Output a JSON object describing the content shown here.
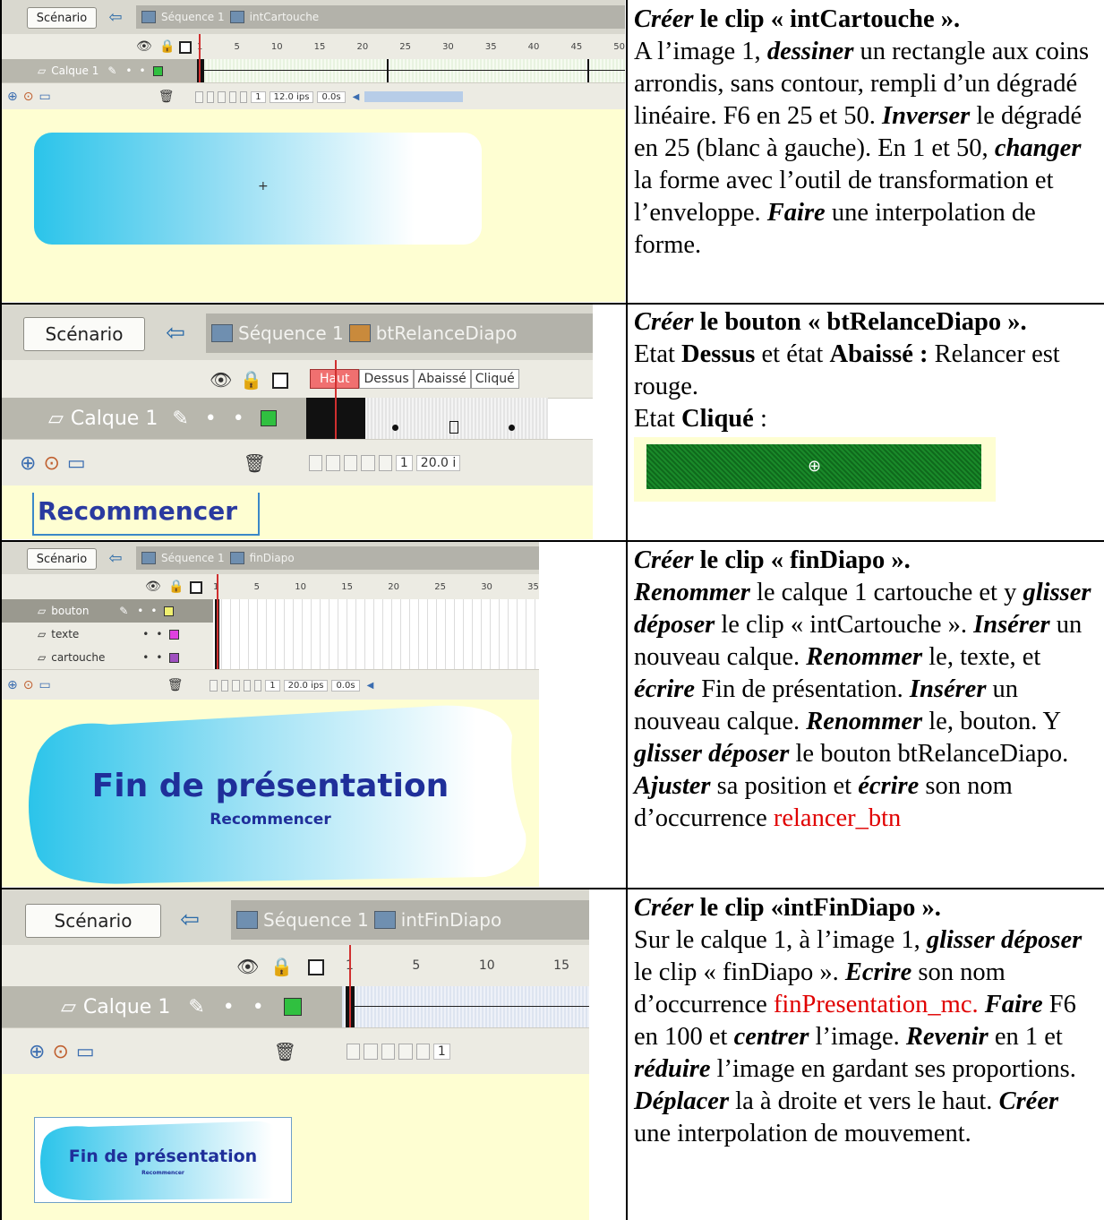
{
  "rows": [
    {
      "ui": {
        "scenario_label": "Scénario",
        "sequence_label": "Séquence 1",
        "symbol_label": "intCartouche",
        "frame_numbers": [
          "1",
          "5",
          "10",
          "15",
          "20",
          "25",
          "30",
          "35",
          "40",
          "45",
          "50"
        ],
        "layers": [
          "Calque 1"
        ],
        "frame_value": "1",
        "fps": "12.0 ips",
        "time": "0.0s"
      },
      "text": {
        "p1_a": "Créer",
        "p1_b": " le clip « intCartouche ».",
        "p2_a": "A l’image 1, ",
        "p2_b": "dessiner",
        "p2_c": " un rectangle aux coins arrondis, sans contour, rempli d’un dégradé linéaire. F6 en 25 et 50. ",
        "p2_d": "Inverser",
        "p2_e": " le dégradé en 25 (blanc à gauche). En 1 et 50, ",
        "p2_f": "changer",
        "p2_g": " la forme avec l’outil de transformation et l’enveloppe. ",
        "p2_h": "Faire",
        "p2_i": " une interpolation de forme."
      }
    },
    {
      "ui": {
        "scenario_label": "Scénario",
        "sequence_label": "Séquence 1",
        "symbol_label": "btRelanceDiapo",
        "states": [
          "Haut",
          "Dessus",
          "Abaissé",
          "Cliqué"
        ],
        "layers": [
          "Calque 1"
        ],
        "frame_value": "1",
        "fps": "20.0 i",
        "stage_text": "Recommencer"
      },
      "text": {
        "p1_a": "Créer",
        "p1_b": " le bouton « btRelanceDiapo ».",
        "p2_a": "Etat ",
        "p2_b": "Dessus",
        "p2_c": " et état ",
        "p2_d": "Abaissé :",
        "p2_e": " Relancer est rouge.",
        "p3_a": "Etat ",
        "p3_b": "Cliqué",
        "p3_c": " :"
      }
    },
    {
      "ui": {
        "scenario_label": "Scénario",
        "sequence_label": "Séquence 1",
        "symbol_label": "finDiapo",
        "frame_numbers": [
          "1",
          "5",
          "10",
          "15",
          "20",
          "25",
          "30",
          "35"
        ],
        "layers": [
          "bouton",
          "texte",
          "cartouche"
        ],
        "layer_colors": [
          "#f0f070",
          "#e040e0",
          "#a050c0"
        ],
        "frame_value": "1",
        "fps": "20.0 ips",
        "time": "0.0s",
        "stage_title": "Fin de présentation",
        "stage_sub": "Recommencer"
      },
      "text": {
        "p1_a": "Créer",
        "p1_b": " le clip « finDiapo ».",
        "p2_a": "Renommer",
        "p2_b": " le calque 1 cartouche et y ",
        "p2_c": "glisser déposer",
        "p2_d": " le clip « intCartouche ». ",
        "p2_e": "Insérer",
        "p2_f": " un nouveau calque. ",
        "p2_g": "Renommer",
        "p2_h": " le, texte, et ",
        "p2_i": "écrire",
        "p2_j": " Fin de présentation. ",
        "p2_k": "Insérer",
        "p2_l": " un nouveau calque. ",
        "p2_m": "Renommer",
        "p2_n": " le, bouton. Y ",
        "p2_o": "glisser déposer",
        "p2_p": " le bouton btRelanceDiapo. ",
        "p2_q": "Ajuster",
        "p2_r": " sa position et ",
        "p2_s": "écrire",
        "p2_t": " son nom d’occurrence ",
        "p2_u": "relancer_btn"
      }
    },
    {
      "ui": {
        "scenario_label": "Scénario",
        "sequence_label": "Séquence 1",
        "symbol_label": "intFinDiapo",
        "frame_numbers": [
          "1",
          "5",
          "10",
          "15"
        ],
        "layers": [
          "Calque 1"
        ],
        "frame_value": "1",
        "stage_title": "Fin de présentation",
        "stage_sub": "Recommencer"
      },
      "text": {
        "p1_a": "Créer",
        "p1_b": " le clip «intFinDiapo ».",
        "p2_a": "Sur le calque 1, à l’image 1, ",
        "p2_b": "glisser déposer",
        "p2_c": " le clip « finDiapo ». ",
        "p2_d": "Ecrire",
        "p2_e": " son nom d’occurrence ",
        "p2_f": "finPresentation_mc.",
        "p2_g": " ",
        "p2_h": "Faire",
        "p2_i": " F6 en 100 et ",
        "p2_j": "centrer",
        "p2_k": " l’image. ",
        "p2_l": "Revenir",
        "p2_m": " en 1 et ",
        "p2_n": "réduire",
        "p2_o": " l’image en gardant ses proportions. ",
        "p2_p": "Déplacer",
        "p2_q": " la à droite et vers le haut. ",
        "p2_r": "Créer",
        "p2_s": " une interpolation de mouvement."
      }
    }
  ]
}
